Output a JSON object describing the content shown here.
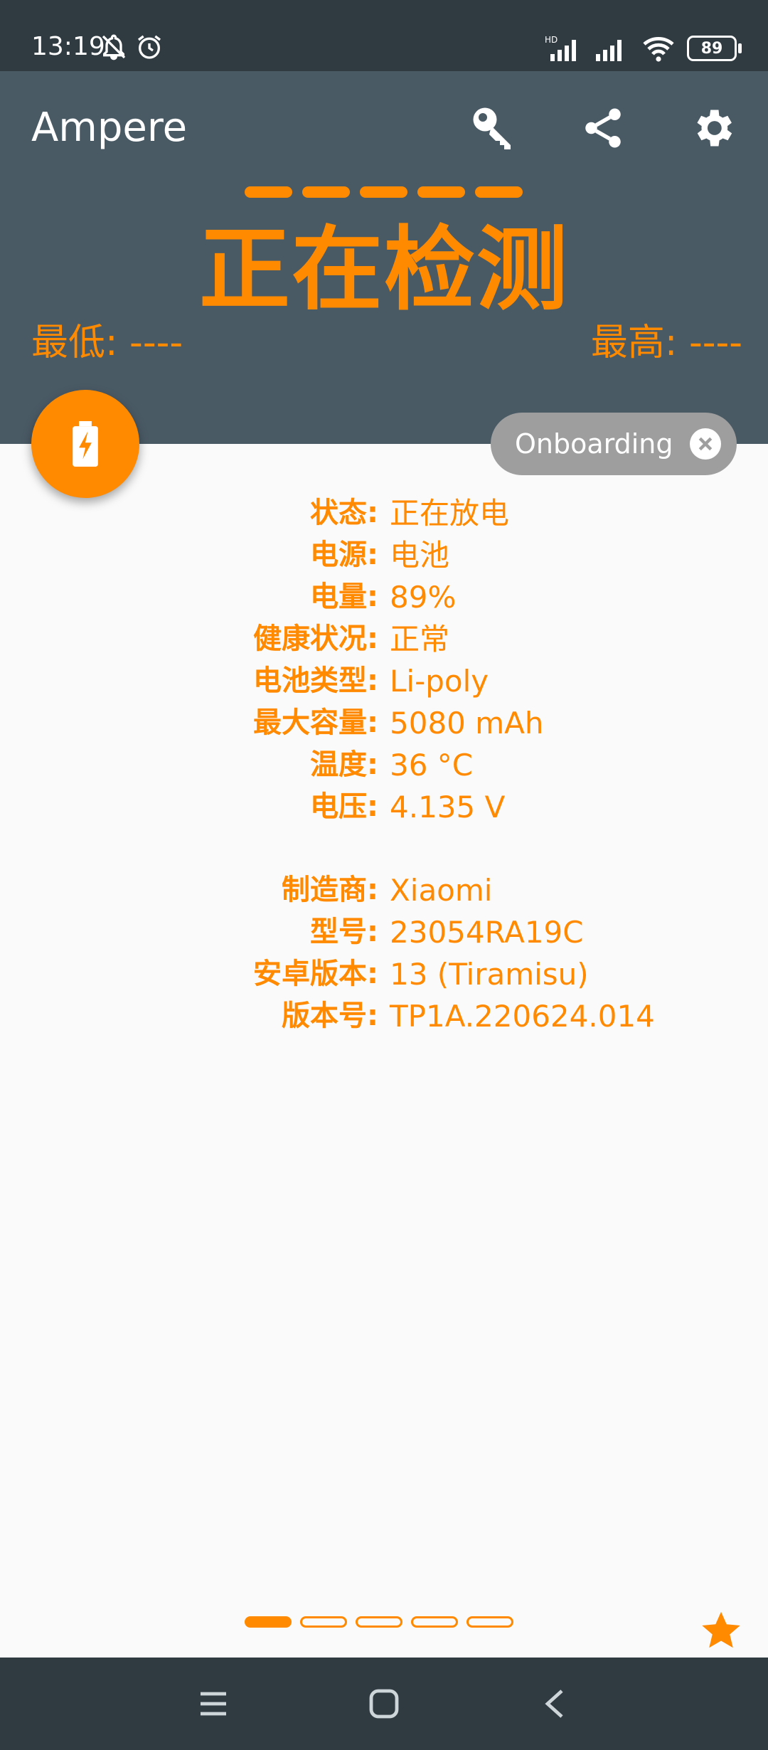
{
  "status_bar": {
    "time": "13:19",
    "battery_level": "89",
    "hd_badge": "HD",
    "icons": [
      "bell-off-icon",
      "alarm-icon",
      "signal-icon",
      "signal-icon",
      "wifi-icon",
      "battery-icon"
    ]
  },
  "app_bar": {
    "title": "Ampere",
    "actions": [
      "key-icon",
      "share-icon",
      "gear-icon"
    ]
  },
  "header": {
    "status": "正在检测",
    "min_label": "最低: ----",
    "max_label": "最高: ----"
  },
  "fab": {
    "icon": "battery-charging-icon"
  },
  "chip": {
    "label": "Onboarding",
    "icon": "close-circle-icon"
  },
  "battery_info": [
    {
      "label": "状态:",
      "value": "正在放电"
    },
    {
      "label": "电源:",
      "value": "电池"
    },
    {
      "label": "电量:",
      "value": "89%"
    },
    {
      "label": "健康状况:",
      "value": "正常"
    },
    {
      "label": "电池类型:",
      "value": "Li-poly"
    },
    {
      "label": "最大容量:",
      "value": "5080 mAh"
    },
    {
      "label": "温度:",
      "value": "36 °C"
    },
    {
      "label": "电压:",
      "value": "4.135 V"
    }
  ],
  "device_info": [
    {
      "label": "制造商:",
      "value": "Xiaomi"
    },
    {
      "label": "型号:",
      "value": "23054RA19C"
    },
    {
      "label": "安卓版本:",
      "value": "13 (Tiramisu)"
    },
    {
      "label": "版本号:",
      "value": "TP1A.220624.014"
    }
  ],
  "pager": {
    "pages": 5,
    "active_index": 0
  },
  "nav_bar": {
    "icons": [
      "menu-icon",
      "home-icon",
      "back-icon"
    ]
  },
  "colors": {
    "accent": "#ff8a00",
    "header_bg": "#4a5a65",
    "status_bg": "#2f3a41",
    "chip_bg": "#9e9e9e",
    "background": "#fafafa"
  }
}
